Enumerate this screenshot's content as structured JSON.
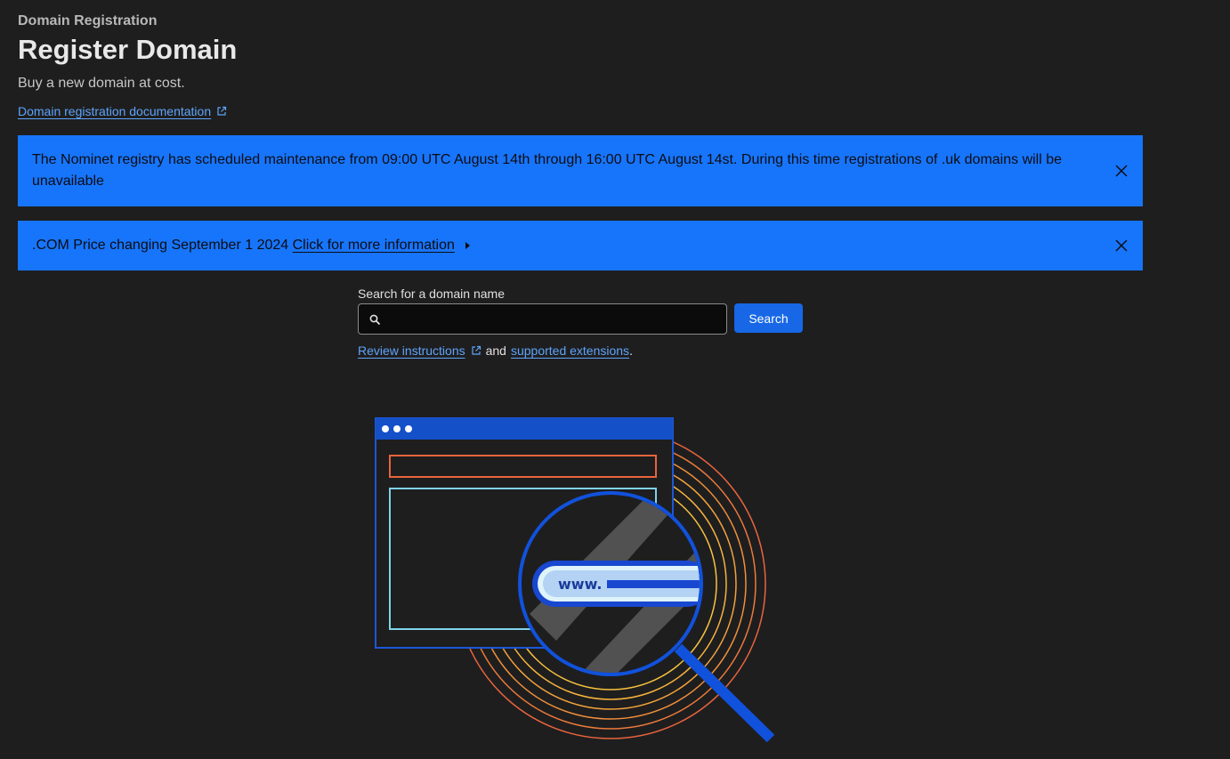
{
  "header": {
    "breadcrumb": "Domain Registration",
    "title": "Register Domain",
    "subtitle": "Buy a new domain at cost.",
    "doc_link": "Domain registration documentation"
  },
  "banners": [
    {
      "text": "The Nominet registry has scheduled maintenance from 09:00 UTC August 14th through 16:00 UTC August 14st. During this time registrations of .uk domains will be unavailable"
    },
    {
      "text": ".COM Price changing September 1 2024",
      "link": "Click for more information"
    }
  ],
  "search": {
    "label": "Search for a domain name",
    "value": "",
    "placeholder": "",
    "button_label": "Search"
  },
  "help": {
    "review_link": "Review instructions",
    "connector": "and",
    "extensions_link": "supported extensions",
    "period": "."
  },
  "illustration": {
    "text": "www."
  },
  "colors": {
    "background": "#1e1e1f",
    "banner": "#1775fc",
    "link": "#5ea4f9",
    "button": "#1767e6"
  }
}
